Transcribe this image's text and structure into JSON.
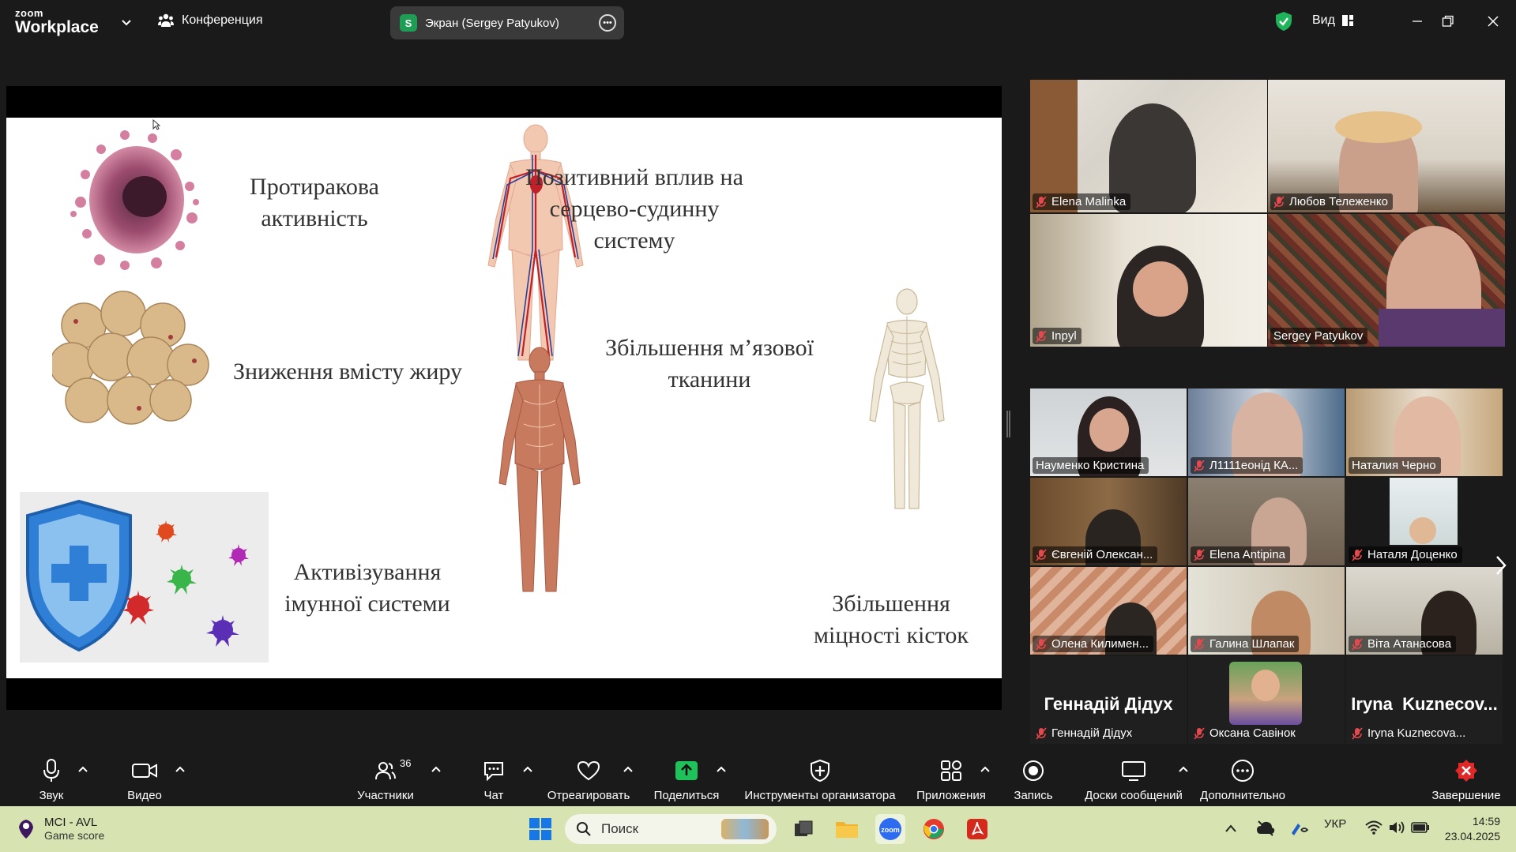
{
  "app": {
    "brand_top": "zoom",
    "brand_bottom": "Workplace",
    "meeting_menu": "Конференция",
    "share_indicator": "Экран (Sergey Patyukov)",
    "share_badge": "S",
    "view_label": "Вид"
  },
  "slide": {
    "items": [
      "Протиракова\nактивність",
      "Позитивний вплив на\nсерцево-судинну\nсистему",
      "Зниження вмісту жиру",
      "Збільшення м’язової\nтканини",
      "Активізування\nімунної системи",
      "Збільшення\nміцності кісток"
    ]
  },
  "speakers": [
    {
      "name": "Elena Malinka",
      "muted": true
    },
    {
      "name": "Любов Тележенко",
      "muted": true
    },
    {
      "name": "Inpyl",
      "muted": true
    },
    {
      "name": "Sergey Patyukov",
      "muted": false,
      "active": true
    }
  ],
  "gallery": [
    {
      "name": "Науменко Кристина",
      "muted": false
    },
    {
      "name": "Л1111еонід КА...",
      "muted": true
    },
    {
      "name": "Наталия Черно",
      "muted": false
    },
    {
      "name": "Євгеній Олексан...",
      "muted": true
    },
    {
      "name": "Elena Antipina",
      "muted": true
    },
    {
      "name": "Наталя Доценко",
      "muted": true
    },
    {
      "name": "Олена Килимен...",
      "muted": true
    },
    {
      "name": "Галина Шлапак",
      "muted": true
    },
    {
      "name": "Віта Атанасова",
      "muted": true
    },
    {
      "name": "Геннадій Дідух",
      "muted": true,
      "no_video": true,
      "big_name": "Геннадій Дідух"
    },
    {
      "name": "Оксана Савінок",
      "muted": true
    },
    {
      "name": "Iryna Kuznecova...",
      "muted": true,
      "no_video": true,
      "big_name": "Iryna  Kuznecov..."
    }
  ],
  "toolbar": {
    "audio": "Звук",
    "video": "Видео",
    "participants": "Участники",
    "participants_count": "36",
    "chat": "Чат",
    "react": "Отреагировать",
    "share": "Поделиться",
    "host_tools": "Инструменты организатора",
    "apps": "Приложения",
    "record": "Запись",
    "whiteboards": "Доски сообщений",
    "more": "Дополнительно",
    "end": "Завершение"
  },
  "taskbar": {
    "weather_title": "MCI - AVL",
    "weather_sub": "Game score",
    "search_placeholder": "Поиск",
    "language": "УКР",
    "time": "14:59",
    "date": "23.04.2025"
  },
  "colors": {
    "accent_green": "#23d18b",
    "share_green": "#1f9d55",
    "mute_red": "#e5484d",
    "end_red": "#e02828",
    "taskbar_bg": "#d7e3b0"
  }
}
